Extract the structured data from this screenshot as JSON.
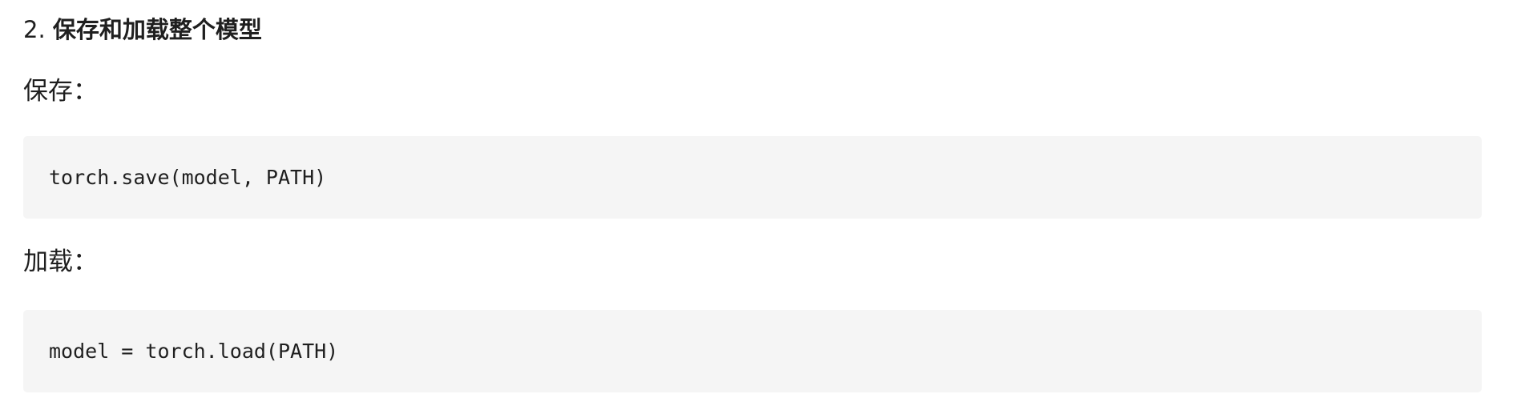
{
  "heading": {
    "number": "2.",
    "title": "保存和加载整个模型"
  },
  "sections": [
    {
      "label": "保存：",
      "code": "torch.save(model, PATH)"
    },
    {
      "label": "加载：",
      "code": "model = torch.load(PATH)"
    }
  ],
  "colors": {
    "code_background": "#f5f5f5",
    "text": "#1f1f1f"
  }
}
